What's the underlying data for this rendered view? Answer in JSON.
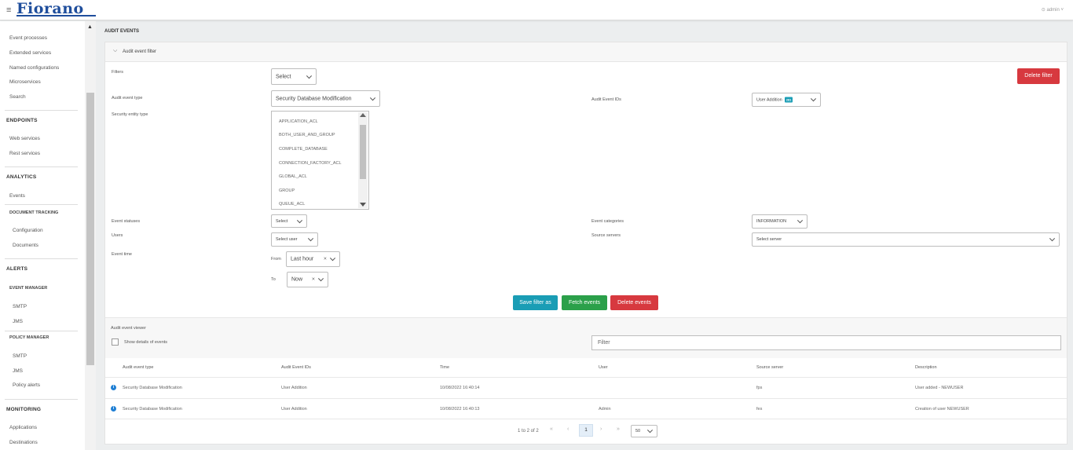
{
  "app": {
    "logo": "Fiorano",
    "user": "admin"
  },
  "sidebar": {
    "items_top": [
      "Event processes",
      "Extended services",
      "Named configurations",
      "Microservices",
      "Search"
    ],
    "endpoints": {
      "title": "ENDPOINTS",
      "items": [
        "Web services",
        "Rest services"
      ]
    },
    "analytics": {
      "title": "ANALYTICS",
      "items": [
        "Events"
      ],
      "doc_tracking": {
        "title": "DOCUMENT TRACKING",
        "items": [
          "Configuration",
          "Documents"
        ]
      }
    },
    "alerts": {
      "title": "ALERTS",
      "event_manager": {
        "title": "EVENT MANAGER",
        "items": [
          "SMTP",
          "JMS"
        ]
      },
      "policy_manager": {
        "title": "POLICY MANAGER",
        "items": [
          "SMTP",
          "JMS",
          "Policy alerts"
        ]
      }
    },
    "monitoring": {
      "title": "MONITORING",
      "items": [
        "Applications",
        "Destinations"
      ]
    }
  },
  "page": {
    "title": "AUDIT EVENTS"
  },
  "filter_panel": {
    "header": "Audit event filter",
    "filters_label": "Filters",
    "filters_value": "Select",
    "delete_filter": "Delete filter",
    "event_type_label": "Audit event type",
    "event_type_value": "Security Database Modification",
    "event_ids_label": "Audit Event IDs",
    "event_ids_value": "User Addition",
    "event_ids_badge": "281",
    "entity_type_label": "Security entity type",
    "entity_types": [
      "APPLICATION_ACL",
      "BOTH_USER_AND_GROUP",
      "COMPLETE_DATABASE",
      "CONNECTION_FACTORY_ACL",
      "GLOBAL_ACL",
      "GROUP",
      "QUEUE_ACL"
    ],
    "statuses_label": "Event statuses",
    "statuses_value": "Select",
    "categories_label": "Event categories",
    "categories_value": "INFORMATION",
    "users_label": "Users",
    "users_value": "Select user",
    "servers_label": "Source servers",
    "servers_value": "Select server",
    "time_label": "Event time",
    "from_label": "From",
    "from_value": "Last hour",
    "to_label": "To",
    "to_value": "Now",
    "save_filter": "Save filter as",
    "fetch_events": "Fetch events",
    "delete_events": "Delete events"
  },
  "viewer": {
    "title": "Audit event viewer",
    "show_details": "Show details of events",
    "filter_placeholder": "Filter",
    "columns": [
      "Audit event type",
      "Audit Event IDs",
      "Time",
      "User",
      "Source server",
      "Description"
    ],
    "rows": [
      [
        "Security Database Modification",
        "User Addition",
        "10/08/2022 16:40:14",
        "",
        "fps",
        "User added - NEWUSER"
      ],
      [
        "Security Database Modification",
        "User Addition",
        "10/08/2022 16:40:13",
        "Admin",
        "fes",
        "Creation of user NEWUSER"
      ]
    ],
    "pager": {
      "summary": "1 to 2 of 2",
      "page": "1",
      "page_size": "50"
    }
  }
}
